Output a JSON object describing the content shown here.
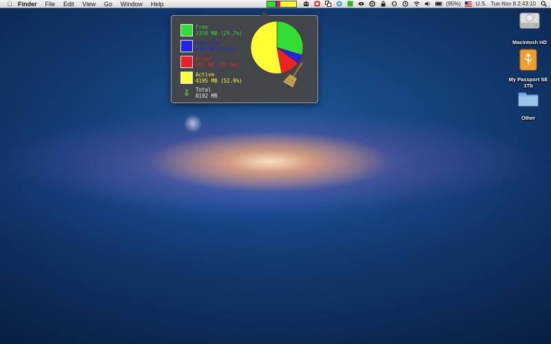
{
  "menubar": {
    "apple_symbol": "",
    "app_name": "Finder",
    "menus": [
      "File",
      "Edit",
      "View",
      "Go",
      "Window",
      "Help"
    ],
    "status_icons": [
      "memory-meter",
      "robot-icon",
      "stop-icon",
      "stack-icon",
      "ubuntu-icon",
      "green-square-icon",
      "eye-icon",
      "capture-icon",
      "lock-icon",
      "sync-icon",
      "time-machine-icon",
      "wifi-icon",
      "volume-icon",
      "battery-icon"
    ],
    "battery_text": "(95%)",
    "input_source": "U.S.",
    "clock": "Tue Nov 8  2:43:10",
    "memory_meter_values": [
      29.7,
      5.4,
      12.0,
      52.9
    ]
  },
  "memory_popup": {
    "free_label": "Free",
    "free_value": "2358 MB (29.7%)",
    "inactive_label": "Inactive",
    "inactive_value": "430 MB (5.4%)",
    "wired_label": "Wired",
    "wired_value": "955 MB (12.0%)",
    "active_label": "Active",
    "active_value": "4195 MB (52.9%)",
    "total_label": "Total",
    "total_value": "8192 MB",
    "colors": {
      "free": "#33dd33",
      "inactive": "#2222ee",
      "wired": "#ee2222",
      "active": "#ffff33"
    }
  },
  "chart_data": {
    "type": "pie",
    "categories": [
      "Free",
      "Inactive",
      "Wired",
      "Active"
    ],
    "values": [
      29.7,
      5.4,
      12.0,
      52.9
    ],
    "colors": [
      "#33dd33",
      "#2222ee",
      "#ee2222",
      "#ffff33"
    ]
  },
  "desktop": {
    "icons": [
      {
        "label": "Macintosh HD",
        "icon": "hard-drive-icon"
      },
      {
        "label": "My Passport SE 1Tb",
        "icon": "external-drive-icon"
      },
      {
        "label": "Other",
        "icon": "folder-icon"
      }
    ]
  }
}
